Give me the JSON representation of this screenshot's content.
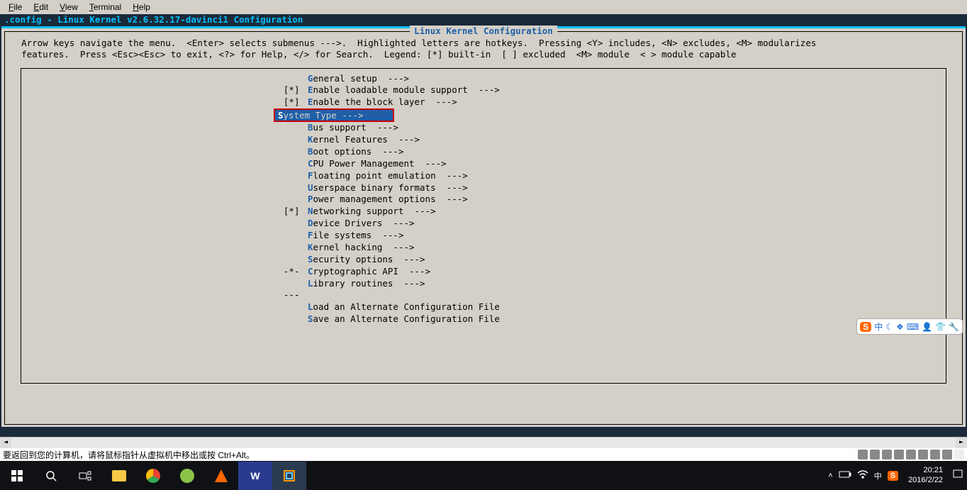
{
  "menubar": {
    "items": [
      {
        "hotkey": "F",
        "label": "ile"
      },
      {
        "hotkey": "E",
        "label": "dit"
      },
      {
        "hotkey": "V",
        "label": "iew"
      },
      {
        "hotkey": "T",
        "label": "erminal"
      },
      {
        "hotkey": "H",
        "label": "elp"
      }
    ]
  },
  "title": " .config - Linux Kernel v2.6.32.17-davinci1 Configuration",
  "box_title": "Linux Kernel Configuration",
  "help_text": "  Arrow keys navigate the menu.  <Enter> selects submenus --->.  Highlighted letters are hotkeys.  Pressing <Y> includes, <N> excludes, <M> modularizes\n  features.  Press <Esc><Esc> to exit, <?> for Help, </> for Search.  Legend: [*] built-in  [ ] excluded  <M> module  < > module capable",
  "menu": [
    {
      "prefix": "    ",
      "hotkey": "G",
      "label": "eneral setup  --->"
    },
    {
      "prefix": "[*] ",
      "hotkey": "E",
      "label": "nable loadable module support  --->"
    },
    {
      "prefix": "[*] ",
      "hotkey": "E",
      "label": "nable the block layer  --->"
    },
    {
      "prefix": "    ",
      "hotkey": "S",
      "label": "ystem Type  --->",
      "selected": true
    },
    {
      "prefix": "    ",
      "hotkey": "B",
      "label": "us support  --->"
    },
    {
      "prefix": "    ",
      "hotkey": "K",
      "label": "ernel Features  --->"
    },
    {
      "prefix": "    ",
      "hotkey": "B",
      "label": "oot options  --->"
    },
    {
      "prefix": "    ",
      "hotkey": "C",
      "label": "PU Power Management  --->"
    },
    {
      "prefix": "    ",
      "hotkey": "F",
      "label": "loating point emulation  --->"
    },
    {
      "prefix": "    ",
      "hotkey": "U",
      "label": "serspace binary formats  --->"
    },
    {
      "prefix": "    ",
      "hotkey": "P",
      "label": "ower management options  --->"
    },
    {
      "prefix": "[*] ",
      "hotkey": "N",
      "label": "etworking support  --->"
    },
    {
      "prefix": "    ",
      "hotkey": "D",
      "label": "evice Drivers  --->"
    },
    {
      "prefix": "    ",
      "hotkey": "F",
      "label": "ile systems  --->"
    },
    {
      "prefix": "    ",
      "hotkey": "K",
      "label": "ernel hacking  --->"
    },
    {
      "prefix": "    ",
      "hotkey": "S",
      "label": "ecurity options  --->"
    },
    {
      "prefix": "-*- ",
      "hotkey": "C",
      "label": "ryptographic API  --->"
    },
    {
      "prefix": "    ",
      "hotkey": "L",
      "label": "ibrary routines  --->"
    },
    {
      "prefix": "--- ",
      "hotkey": "",
      "label": ""
    },
    {
      "prefix": "    ",
      "hotkey": "L",
      "label": "oad an Alternate Configuration File"
    },
    {
      "prefix": "    ",
      "hotkey": "S",
      "label": "ave an Alternate Configuration File"
    }
  ],
  "ime": {
    "badge": "S",
    "items": [
      "中",
      "☾",
      "❖",
      "⌨",
      "👤",
      "👕",
      "🔧"
    ]
  },
  "vm_hint": "要返回到您的计算机，请将鼠标指针从虚拟机中移出或按 Ctrl+Alt。",
  "taskbar": {
    "clock_time": "20:21",
    "clock_date": "2016/2/22",
    "tray": [
      "中",
      "S"
    ]
  }
}
